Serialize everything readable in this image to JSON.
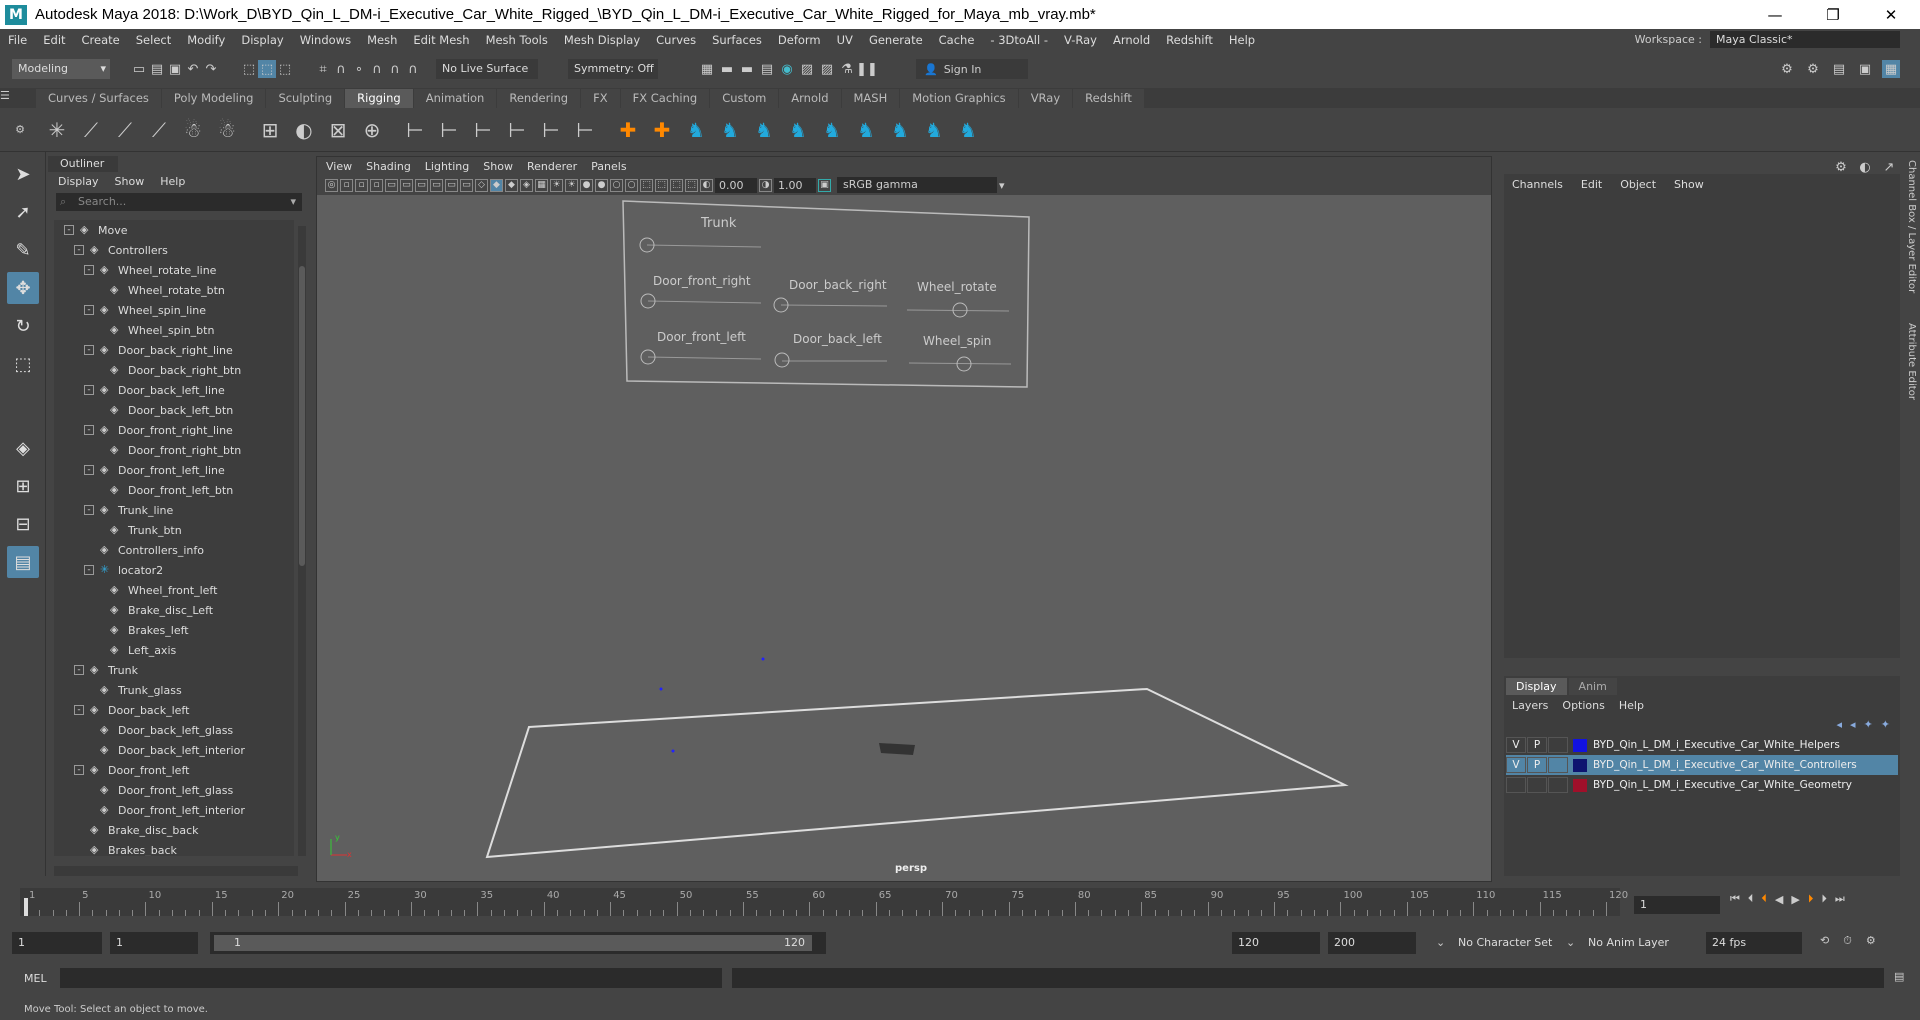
{
  "window": {
    "logo": "M",
    "title": "Autodesk Maya 2018: D:\\Work_D\\BYD_Qin_L_DM-i_Executive_Car_White_Rigged_\\BYD_Qin_L_DM-i_Executive_Car_White_Rigged_for_Maya_mb_vray.mb*",
    "minimize": "—",
    "maximize": "❐",
    "close": "✕"
  },
  "menubar": {
    "items": [
      "File",
      "Edit",
      "Create",
      "Select",
      "Modify",
      "Display",
      "Windows",
      "Mesh",
      "Edit Mesh",
      "Mesh Tools",
      "Mesh Display",
      "Curves",
      "Surfaces",
      "Deform",
      "UV",
      "Generate",
      "Cache",
      "- 3DtoAll -",
      "V-Ray",
      "Arnold",
      "Redshift",
      "Help"
    ],
    "workspace_label": "Workspace :",
    "workspace_value": "Maya Classic*"
  },
  "statusline": {
    "mode": "Modeling",
    "live_surface": "No Live Surface",
    "symmetry": "Symmetry: Off",
    "sign_in": "Sign In"
  },
  "shelf_tabs": [
    "Curves / Surfaces",
    "Poly Modeling",
    "Sculpting",
    "Rigging",
    "Animation",
    "Rendering",
    "FX",
    "FX Caching",
    "Custom",
    "Arnold",
    "MASH",
    "Motion Graphics",
    "VRay",
    "Redshift"
  ],
  "shelf_active": "Rigging",
  "outliner": {
    "title": "Outliner",
    "menu": [
      "Display",
      "Show",
      "Help"
    ],
    "search_placeholder": "Search...",
    "items": [
      {
        "label": "Move",
        "depth": 0,
        "tog": "-"
      },
      {
        "label": "Controllers",
        "depth": 1,
        "tog": "-"
      },
      {
        "label": "Wheel_rotate_line",
        "depth": 2,
        "tog": "-"
      },
      {
        "label": "Wheel_rotate_btn",
        "depth": 3,
        "tog": ""
      },
      {
        "label": "Wheel_spin_line",
        "depth": 2,
        "tog": "-"
      },
      {
        "label": "Wheel_spin_btn",
        "depth": 3,
        "tog": ""
      },
      {
        "label": "Door_back_right_line",
        "depth": 2,
        "tog": "-"
      },
      {
        "label": "Door_back_right_btn",
        "depth": 3,
        "tog": ""
      },
      {
        "label": "Door_back_left_line",
        "depth": 2,
        "tog": "-"
      },
      {
        "label": "Door_back_left_btn",
        "depth": 3,
        "tog": ""
      },
      {
        "label": "Door_front_right_line",
        "depth": 2,
        "tog": "-"
      },
      {
        "label": "Door_front_right_btn",
        "depth": 3,
        "tog": ""
      },
      {
        "label": "Door_front_left_line",
        "depth": 2,
        "tog": "-"
      },
      {
        "label": "Door_front_left_btn",
        "depth": 3,
        "tog": ""
      },
      {
        "label": "Trunk_line",
        "depth": 2,
        "tog": "-"
      },
      {
        "label": "Trunk_btn",
        "depth": 3,
        "tog": ""
      },
      {
        "label": "Controllers_info",
        "depth": 2,
        "tog": ""
      },
      {
        "label": "locator2",
        "depth": 2,
        "tog": "-",
        "icon": "locator"
      },
      {
        "label": "Wheel_front_left",
        "depth": 3,
        "tog": ""
      },
      {
        "label": "Brake_disc_Left",
        "depth": 3,
        "tog": ""
      },
      {
        "label": "Brakes_left",
        "depth": 3,
        "tog": ""
      },
      {
        "label": "Left_axis",
        "depth": 3,
        "tog": ""
      },
      {
        "label": "Trunk",
        "depth": 1,
        "tog": "-"
      },
      {
        "label": "Trunk_glass",
        "depth": 2,
        "tog": ""
      },
      {
        "label": "Door_back_left",
        "depth": 1,
        "tog": "-"
      },
      {
        "label": "Door_back_left_glass",
        "depth": 2,
        "tog": ""
      },
      {
        "label": "Door_back_left_interior",
        "depth": 2,
        "tog": ""
      },
      {
        "label": "Door_front_left",
        "depth": 1,
        "tog": "-"
      },
      {
        "label": "Door_front_left_glass",
        "depth": 2,
        "tog": ""
      },
      {
        "label": "Door_front_left_interior",
        "depth": 2,
        "tog": ""
      },
      {
        "label": "Brake_disc_back",
        "depth": 1,
        "tog": ""
      },
      {
        "label": "Brakes_back",
        "depth": 1,
        "tog": ""
      }
    ]
  },
  "viewport": {
    "menu": [
      "View",
      "Shading",
      "Lighting",
      "Show",
      "Renderer",
      "Panels"
    ],
    "exposure": "0.00",
    "gamma": "1.00",
    "colorspace": "sRGB gamma",
    "camera_label": "persp",
    "controls": {
      "trunk": "Trunk",
      "door_front_right": "Door_front_right",
      "door_back_right": "Door_back_right",
      "wheel_rotate": "Wheel_rotate",
      "door_front_left": "Door_front_left",
      "door_back_left": "Door_back_left",
      "wheel_spin": "Wheel_spin"
    },
    "axis_x": "x",
    "axis_y": "y"
  },
  "channelbox": {
    "menu": [
      "Channels",
      "Edit",
      "Object",
      "Show"
    ]
  },
  "layers": {
    "tabs": [
      "Display",
      "Anim"
    ],
    "menu": [
      "Layers",
      "Options",
      "Help"
    ],
    "rows": [
      {
        "v": "V",
        "p": "P",
        "color": "#1212e0",
        "name": "BYD_Qin_L_DM_i_Executive_Car_White_Helpers",
        "selected": false
      },
      {
        "v": "V",
        "p": "P",
        "color": "#0e1470",
        "name": "BYD_Qin_L_DM_i_Executive_Car_White_Controllers",
        "selected": true
      },
      {
        "v": "",
        "p": "",
        "color": "#a0102a",
        "name": "BYD_Qin_L_DM_i_Executive_Car_White_Geometry",
        "selected": false
      }
    ]
  },
  "side_tabs": [
    "Channel Box / Layer Editor",
    "Attribute Editor"
  ],
  "timeslider": {
    "ticks": [
      "1",
      "5",
      "10",
      "15",
      "20",
      "25",
      "30",
      "35",
      "40",
      "45",
      "50",
      "55",
      "60",
      "65",
      "70",
      "75",
      "80",
      "85",
      "90",
      "95",
      "100",
      "105",
      "110",
      "115",
      "120"
    ],
    "current_frame": "1"
  },
  "range": {
    "start": "1",
    "anim_start": "1",
    "slider_start": "1",
    "slider_end": "120",
    "end": "120",
    "anim_end": "200",
    "character_set": "No Character Set",
    "anim_layer": "No Anim Layer",
    "fps": "24 fps"
  },
  "mel": {
    "label": "MEL"
  },
  "help_line": "Move Tool: Select an object to move."
}
